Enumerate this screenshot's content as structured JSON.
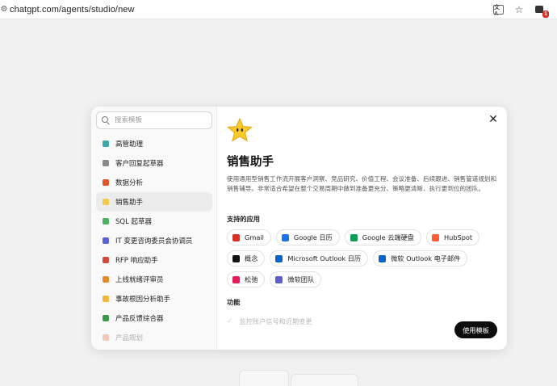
{
  "browser": {
    "url": "chatgpt.com/agents/studio/new",
    "icons": [
      "tune-icon",
      "translate-icon",
      "star-icon",
      "extension-icon"
    ],
    "extension_badge": "1"
  },
  "modal": {
    "search_placeholder": "搜索模板",
    "templates": [
      {
        "label": "高管助理",
        "color": "#3aa8a8"
      },
      {
        "label": "客户回复起草器",
        "color": "#8a8a8a"
      },
      {
        "label": "数据分析",
        "color": "#e0562b"
      },
      {
        "label": "销售助手",
        "color": "#f2c84b"
      },
      {
        "label": "SQL 起草器",
        "color": "#4ab464"
      },
      {
        "label": "IT 变更咨询委员会协调员",
        "color": "#5a63d6"
      },
      {
        "label": "RFP 响应助手",
        "color": "#d24a3a"
      },
      {
        "label": "上线就绪评审员",
        "color": "#e58a2a"
      },
      {
        "label": "事故根因分析助手",
        "color": "#f0b73a"
      },
      {
        "label": "产品反馈综合器",
        "color": "#3a9a4a"
      },
      {
        "label": "产品规划",
        "color": "#e0724a"
      }
    ],
    "selected_index": 3,
    "title": "销售助手",
    "description": "使用通用型销售工作流开展客户洞察、竞品研究、价值工程、会议准备、后续跟进、销售管道规划和销售辅导。非常适合希望在整个交易周期中做到准备更充分、策略更清晰、执行更到位的团队。",
    "apps_label": "支持的应用",
    "apps": [
      {
        "label": "Gmail",
        "icon": "gmail-icon",
        "color": "#d93025"
      },
      {
        "label": "Google 日历",
        "icon": "google-calendar-icon",
        "color": "#1a73e8"
      },
      {
        "label": "Google 云端硬盘",
        "icon": "google-drive-icon",
        "color": "#0f9d58"
      },
      {
        "label": "HubSpot",
        "icon": "hubspot-icon",
        "color": "#ff5c35"
      },
      {
        "label": "概念",
        "icon": "notion-icon",
        "color": "#111111"
      },
      {
        "label": "Microsoft Outlook 日历",
        "icon": "outlook-icon",
        "color": "#0a64c8"
      },
      {
        "label": "微软 Outlook 电子邮件",
        "icon": "outlook-mail-icon",
        "color": "#0a64c8"
      },
      {
        "label": "松弛",
        "icon": "slack-icon",
        "color": "#e01e5a"
      },
      {
        "label": "微软团队",
        "icon": "teams-icon",
        "color": "#5b5fc7"
      }
    ],
    "features_label": "功能",
    "features": [
      "监控账户信号和近期变更"
    ],
    "use_button": "使用模板",
    "close_icon": "close-icon"
  }
}
